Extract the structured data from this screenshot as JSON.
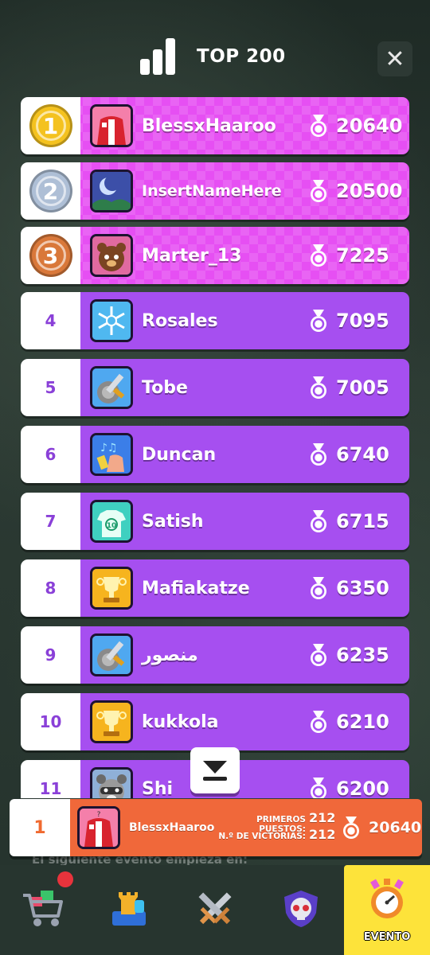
{
  "header": {
    "title": "TOP 200",
    "close_label": "✕"
  },
  "leaderboard": [
    {
      "rank": "1",
      "name": "BlessxHaaroo",
      "score": "20640",
      "tier": "gold",
      "avatar": "red-jacket-avatar"
    },
    {
      "rank": "2",
      "name": "InsertNameHere",
      "score": "20500",
      "tier": "silver",
      "avatar": "night-moon-avatar"
    },
    {
      "rank": "3",
      "name": "Marter_13",
      "score": "7225",
      "tier": "bronze",
      "avatar": "bear-avatar"
    },
    {
      "rank": "4",
      "name": "Rosales",
      "score": "7095",
      "tier": "normal",
      "avatar": "snowflake-avatar"
    },
    {
      "rank": "5",
      "name": "Tobe",
      "score": "7005",
      "tier": "normal",
      "avatar": "sword-shield-avatar"
    },
    {
      "rank": "6",
      "name": "Duncan",
      "score": "6740",
      "tier": "normal",
      "avatar": "music-hand-avatar"
    },
    {
      "rank": "7",
      "name": "Satish",
      "score": "6715",
      "tier": "normal",
      "avatar": "jersey-10-avatar"
    },
    {
      "rank": "8",
      "name": "Mafiakatze",
      "score": "6350",
      "tier": "normal",
      "avatar": "trophy-avatar"
    },
    {
      "rank": "9",
      "name": "منصور",
      "score": "6235",
      "tier": "normal",
      "avatar": "sword-shield-avatar"
    },
    {
      "rank": "10",
      "name": "kukkola",
      "score": "6210",
      "tier": "normal",
      "avatar": "trophy-avatar"
    },
    {
      "rank": "11",
      "name": "Shi",
      "score": "6200",
      "tier": "normal",
      "avatar": "raccoon-avatar"
    }
  ],
  "my_rank": {
    "rank": "1",
    "name": "BlessxHaaroo",
    "first_places_label": "PRIMEROS PUESTOS:",
    "first_places": "212",
    "wins_label": "N.º DE VICTORIAS:",
    "wins": "212",
    "score": "20640"
  },
  "next_event_text": "El siguiente evento empieza en:",
  "nav": [
    {
      "name": "shop",
      "icon": "cart-icon",
      "label": "",
      "badge": true
    },
    {
      "name": "rooms",
      "icon": "chess-rook-icon",
      "label": "",
      "badge": false
    },
    {
      "name": "battle",
      "icon": "crossed-swords-icon",
      "label": "",
      "badge": false
    },
    {
      "name": "team",
      "icon": "skull-shield-icon",
      "label": "",
      "badge": false
    },
    {
      "name": "event",
      "icon": "stopwatch-icon",
      "label": "EVENTO",
      "badge": false
    }
  ],
  "colors": {
    "top_row": "#e64ff3",
    "normal_row": "#a64ff0",
    "rank_text": "#8a40d8",
    "my_row": "#f0683a",
    "event_tab": "#fde33a",
    "gold": "#f4c21f",
    "silver": "#aebfd6",
    "bronze": "#d9783a"
  }
}
